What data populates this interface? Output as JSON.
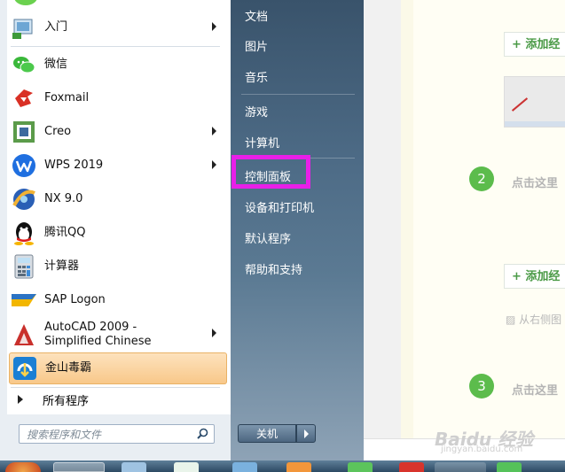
{
  "start_menu": {
    "programs": [
      {
        "label": "入门",
        "has_submenu": true,
        "icon": "getting-started-icon"
      },
      {
        "label": "微信",
        "has_submenu": false,
        "icon": "wechat-icon"
      },
      {
        "label": "Foxmail",
        "has_submenu": false,
        "icon": "foxmail-icon"
      },
      {
        "label": "Creo",
        "has_submenu": true,
        "icon": "creo-icon"
      },
      {
        "label": "WPS 2019",
        "has_submenu": true,
        "icon": "wps-icon"
      },
      {
        "label": "NX 9.0",
        "has_submenu": false,
        "icon": "nx-icon"
      },
      {
        "label": "腾讯QQ",
        "has_submenu": false,
        "icon": "qq-icon"
      },
      {
        "label": "计算器",
        "has_submenu": false,
        "icon": "calculator-icon"
      },
      {
        "label": "SAP Logon",
        "has_submenu": false,
        "icon": "sap-icon"
      },
      {
        "label": "AutoCAD 2009 - Simplified Chinese",
        "has_submenu": true,
        "icon": "autocad-icon"
      },
      {
        "label": "金山毒霸",
        "has_submenu": false,
        "icon": "kingsoft-antivirus-icon",
        "highlighted": true
      }
    ],
    "all_programs": "所有程序",
    "search_placeholder": "搜索程序和文件",
    "right_links": [
      {
        "label": "文档"
      },
      {
        "label": "图片"
      },
      {
        "label": "音乐"
      },
      {
        "label": "游戏"
      },
      {
        "label": "计算机"
      },
      {
        "label": "控制面板",
        "boxed": true
      },
      {
        "label": "设备和打印机"
      },
      {
        "label": "默认程序"
      },
      {
        "label": "帮助和支持"
      }
    ],
    "shutdown_label": "关机",
    "highlight_color": "#e81fe8"
  },
  "background_page": {
    "add_buttons": [
      "+ 添加经",
      "+ 添加经"
    ],
    "steps": [
      {
        "number": "2",
        "text": "点击这里"
      },
      {
        "number": "3",
        "text": "点击这里"
      }
    ],
    "hint": "从右侧图",
    "watermark": "Baidu 经验",
    "watermark_sub": "jingyan.baidu.com",
    "accent": "#5cbc4c"
  }
}
